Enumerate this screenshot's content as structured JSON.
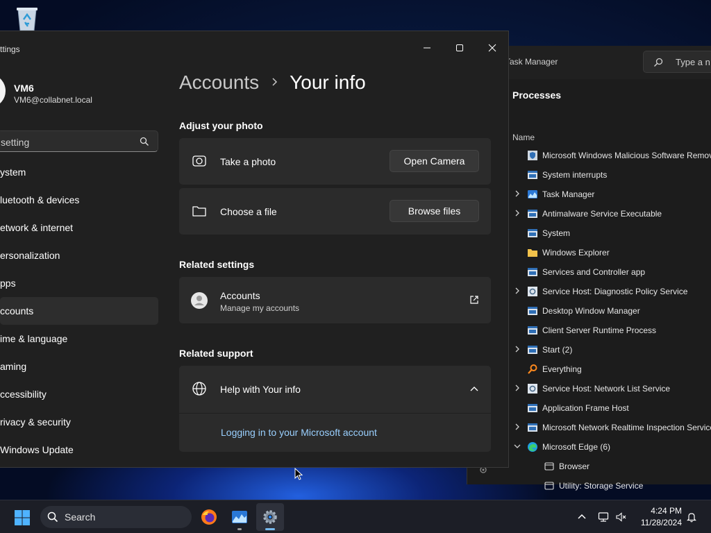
{
  "desktop": {
    "recycle_bin_icon": "recycle-bin-icon"
  },
  "task_manager": {
    "title": "Task Manager",
    "search_placeholder": "Type a n",
    "heading": "Processes",
    "column_name": "Name",
    "processes": [
      {
        "label": "Microsoft Windows Malicious Software Remov",
        "icon": "shield-app-icon",
        "expandable": false
      },
      {
        "label": "System interrupts",
        "icon": "window-app-icon",
        "expandable": false
      },
      {
        "label": "Task Manager",
        "icon": "task-manager-icon",
        "expandable": true
      },
      {
        "label": "Antimalware Service Executable",
        "icon": "window-app-icon",
        "expandable": true
      },
      {
        "label": "System",
        "icon": "window-app-icon",
        "expandable": false
      },
      {
        "label": "Windows Explorer",
        "icon": "folder-icon",
        "expandable": false
      },
      {
        "label": "Services and Controller app",
        "icon": "window-app-icon",
        "expandable": false
      },
      {
        "label": "Service Host: Diagnostic Policy Service",
        "icon": "gear-app-icon",
        "expandable": true
      },
      {
        "label": "Desktop Window Manager",
        "icon": "window-app-icon",
        "expandable": false
      },
      {
        "label": "Client Server Runtime Process",
        "icon": "window-app-icon",
        "expandable": false
      },
      {
        "label": "Start (2)",
        "icon": "window-app-icon",
        "expandable": true
      },
      {
        "label": "Everything",
        "icon": "magnifier-app-icon",
        "expandable": false
      },
      {
        "label": "Service Host: Network List Service",
        "icon": "gear-app-icon",
        "expandable": true
      },
      {
        "label": "Application Frame Host",
        "icon": "window-app-icon",
        "expandable": false
      },
      {
        "label": "Microsoft Network Realtime Inspection Service",
        "icon": "window-app-icon",
        "expandable": true
      },
      {
        "label": "Microsoft Edge (6)",
        "icon": "edge-icon",
        "expandable": true,
        "expanded": true
      },
      {
        "label": "Browser",
        "icon": "browser-tab-icon",
        "child": true
      },
      {
        "label": "Utility: Storage Service",
        "icon": "browser-tab-icon",
        "child": true
      }
    ]
  },
  "settings": {
    "window_title": "ttings",
    "profile": {
      "name": "VM6",
      "email": "VM6@collabnet.local"
    },
    "search_placeholder": "setting",
    "nav": [
      {
        "label": "ystem",
        "selected": false
      },
      {
        "label": "luetooth & devices",
        "selected": false
      },
      {
        "label": "etwork & internet",
        "selected": false
      },
      {
        "label": "ersonalization",
        "selected": false
      },
      {
        "label": "pps",
        "selected": false
      },
      {
        "label": "ccounts",
        "selected": true
      },
      {
        "label": "ime & language",
        "selected": false
      },
      {
        "label": "aming",
        "selected": false
      },
      {
        "label": "ccessibility",
        "selected": false
      },
      {
        "label": "rivacy & security",
        "selected": false
      },
      {
        "label": "Windows Update",
        "selected": false
      }
    ],
    "breadcrumb": {
      "parent": "Accounts",
      "current": "Your info"
    },
    "adjust_photo": {
      "title": "Adjust your photo",
      "take_photo_label": "Take a photo",
      "open_camera_label": "Open Camera",
      "choose_file_label": "Choose a file",
      "browse_files_label": "Browse files"
    },
    "related_settings": {
      "title": "Related settings",
      "accounts_label": "Accounts",
      "accounts_sub": "Manage my accounts"
    },
    "related_support": {
      "title": "Related support",
      "help_label": "Help with Your info",
      "link_label": "Logging in to your Microsoft account"
    }
  },
  "taskbar": {
    "search_label": "Search",
    "time": "4:24 PM",
    "date": "11/28/2024",
    "apps": [
      "firefox-icon",
      "task-manager-icon",
      "settings-gear-icon"
    ],
    "tray": [
      "chevron-up-icon",
      "network-icon",
      "volume-muted-icon",
      "notification-bell-icon"
    ]
  },
  "colors": {
    "accent": "#76b9ed",
    "link": "#9ad0ff",
    "card_bg": "#2b2b2b",
    "window_bg": "#202020"
  }
}
